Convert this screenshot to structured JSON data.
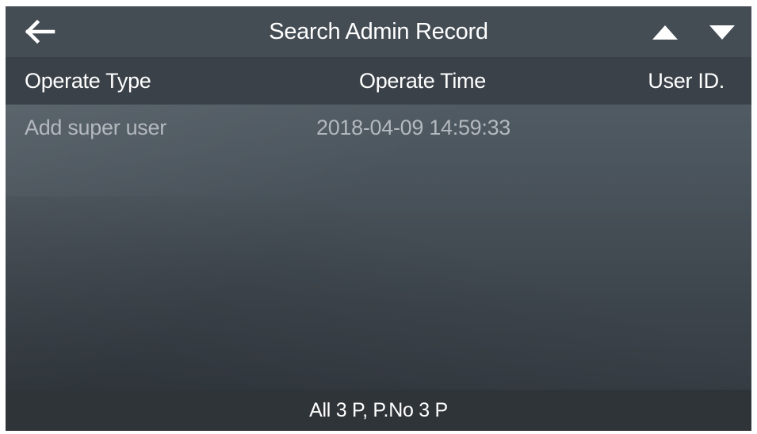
{
  "header": {
    "title": "Search Admin Record",
    "back_icon": "back-arrow-icon",
    "page_up_icon": "triangle-up-icon",
    "page_down_icon": "triangle-down-icon"
  },
  "table": {
    "columns": [
      "Operate Type",
      "Operate Time",
      "User ID."
    ],
    "rows": [
      {
        "operate_type": "Add super user",
        "operate_time": "2018-04-09 14:59:33",
        "user_id": ""
      }
    ]
  },
  "footer": {
    "pagination": "All 3 P, P.No 3 P"
  },
  "colors": {
    "header_bg": "#444c54",
    "column_header_bg": "#3a4148",
    "footer_bg": "#2f3439",
    "row_text": "#b3b9be",
    "text": "#ffffff"
  }
}
